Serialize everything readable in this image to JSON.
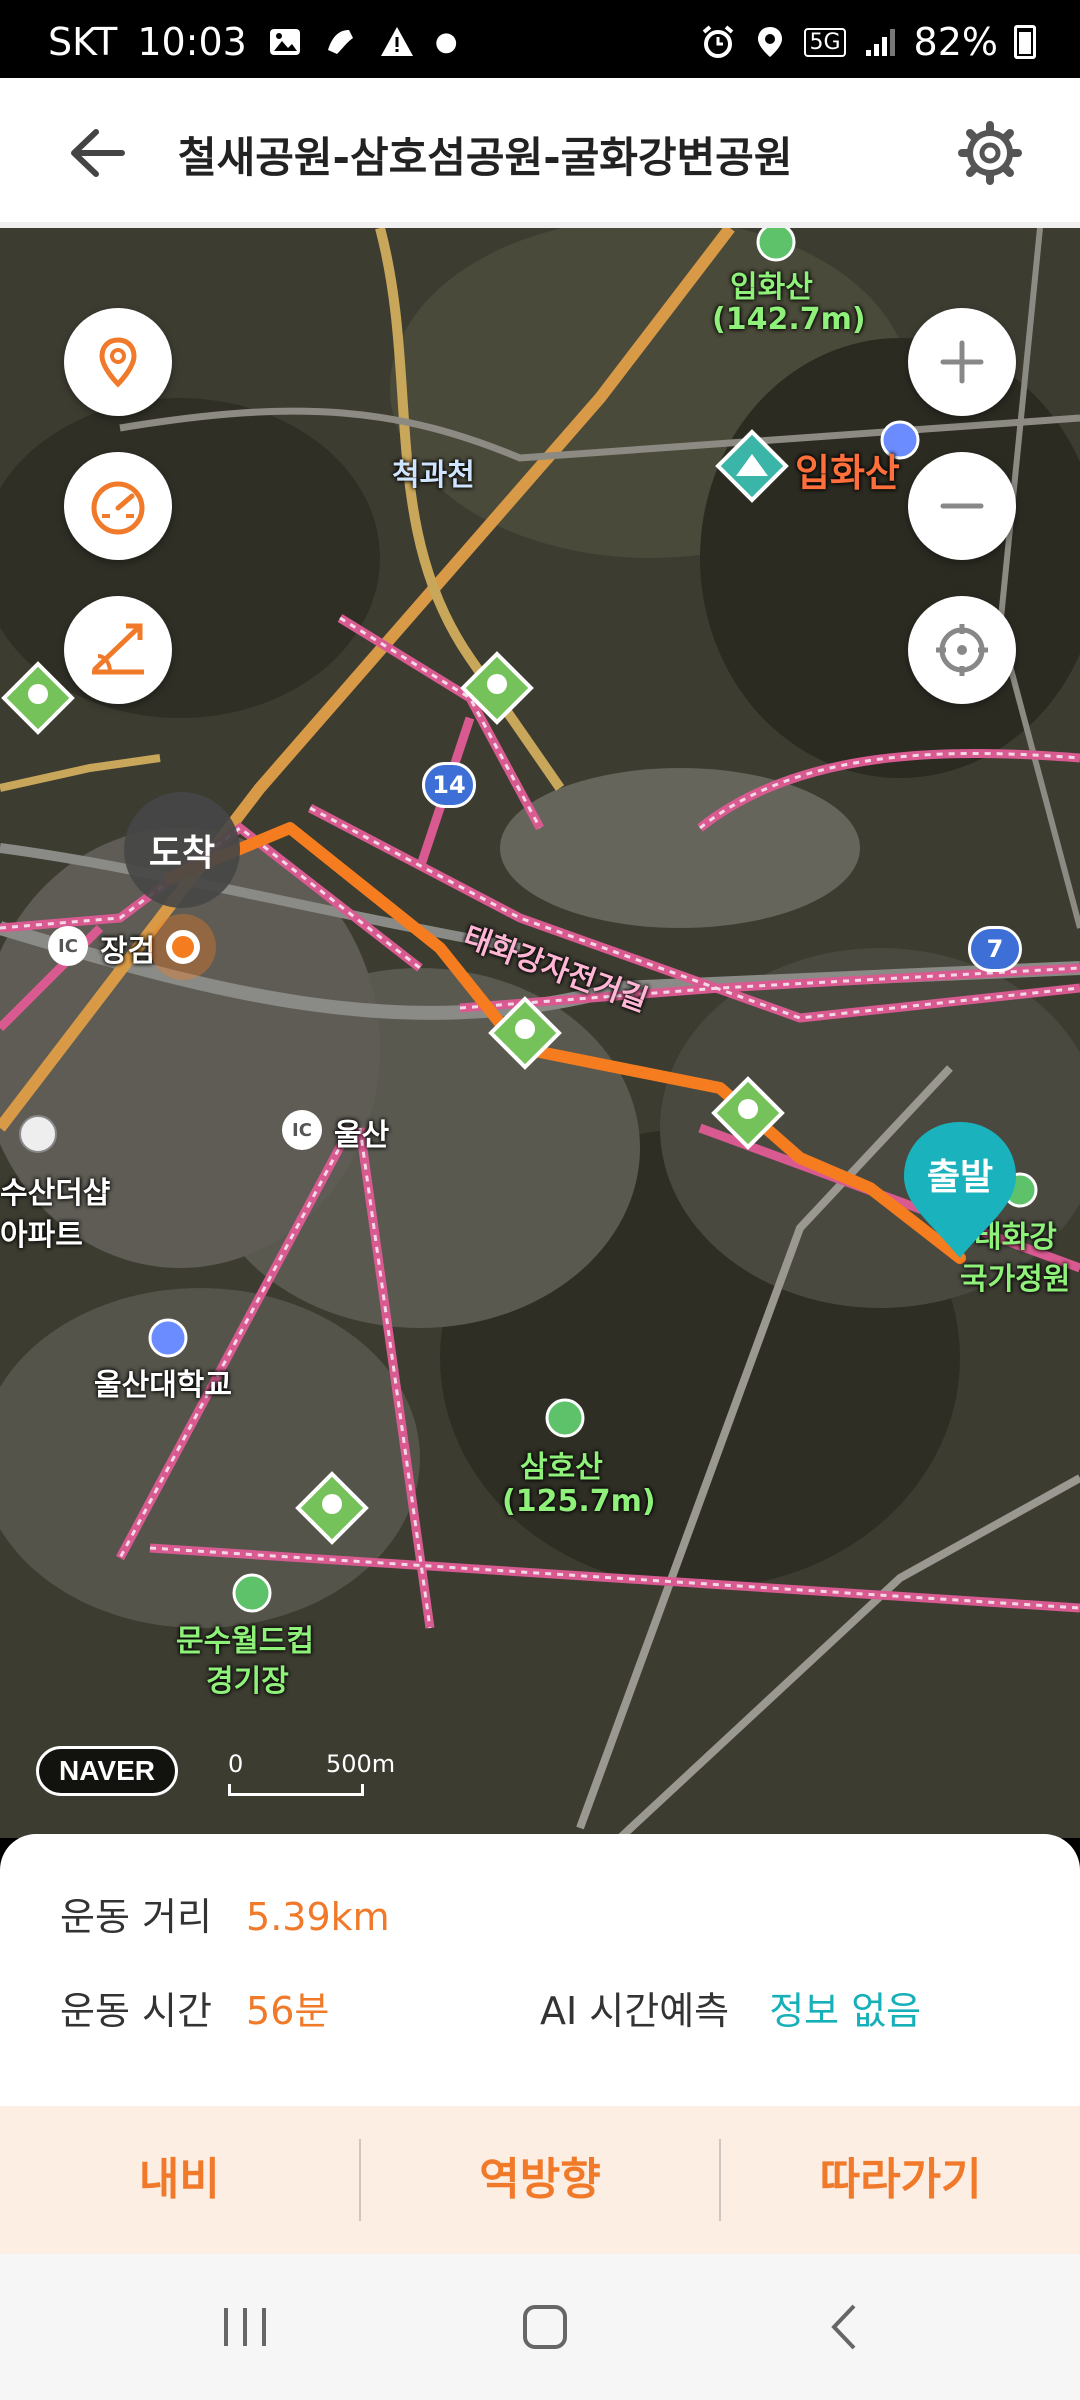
{
  "status_bar": {
    "carrier": "SKT",
    "time": "10:03",
    "network": "5G",
    "battery": "82%"
  },
  "header": {
    "title": "철새공원-삼호섬공원-굴화강변공원"
  },
  "map": {
    "labels": {
      "ipwhasan": "입화산",
      "ipwhasan_alt": "(142.7m)",
      "ipwhasan_poi": "입화산",
      "cheokgwacheon": "척과천",
      "route14": "14",
      "route7": "7",
      "bike_road_1": "태화강자전거길",
      "ic_janggeom": "장검",
      "ic_ulsan": "울산",
      "ic_badge": "IC",
      "sudeoksap_1": "수산더샵",
      "sudeoksap_2": "아파트",
      "ulsan_univ": "울산대학교",
      "samhosan": "삼호산",
      "samhosan_alt": "(125.7m)",
      "munsu_1": "문수월드컵",
      "munsu_2": "경기장",
      "taehwa_1": "태화강",
      "taehwa_2": "국가정원"
    },
    "arrival_pin": "도착",
    "start_pin": "출발",
    "logo": "NAVER",
    "scale_zero": "0",
    "scale_label": "500m",
    "route_color": "#f57c1f"
  },
  "info": {
    "distance_label": "운동 거리",
    "distance_value": "5.39km",
    "time_label": "운동 시간",
    "time_value": "56분",
    "ai_label": "AI 시간예측",
    "ai_value": "정보 없음"
  },
  "actions": {
    "navi": "내비",
    "reverse": "역방향",
    "follow": "따라가기"
  }
}
